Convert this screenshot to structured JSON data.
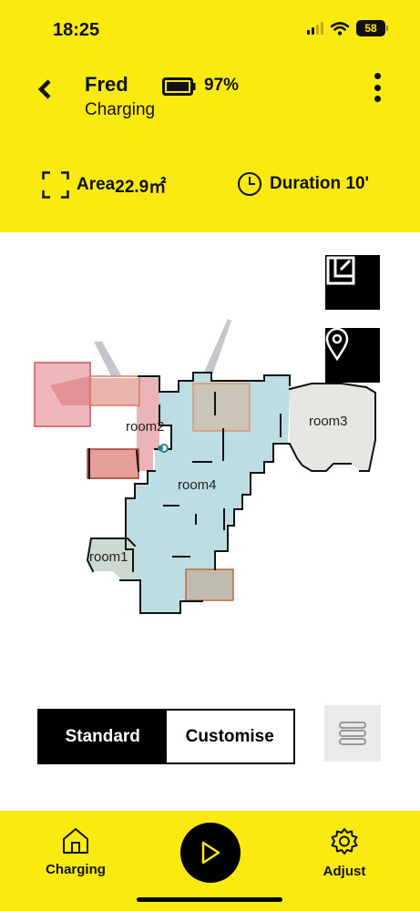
{
  "status_bar": {
    "time": "18:25",
    "battery": "58"
  },
  "header": {
    "robot_name": "Fred",
    "robot_status": "Charging",
    "battery_percent": "97%",
    "area_label": "Area",
    "area_value": "22.9㎡",
    "duration_label": "Duration 10'"
  },
  "map": {
    "rooms": [
      {
        "name": "room1"
      },
      {
        "name": "room2"
      },
      {
        "name": "room3"
      },
      {
        "name": "room4"
      }
    ],
    "colors": {
      "room4": "#bcdde1",
      "room3": "#e6e6e2",
      "room1": "#cdd8d0",
      "room2": "#ebb5b8",
      "zone_fill": "#e89a96",
      "zone_border": "#c2353b",
      "wall": "#111111"
    }
  },
  "mode": {
    "standard": "Standard",
    "customise": "Customise",
    "selected": "Standard"
  },
  "bottom_nav": {
    "charging": "Charging",
    "adjust": "Adjust"
  },
  "icons": {
    "back": "chevron-left-icon",
    "battery": "battery-icon",
    "more": "more-vertical-icon",
    "area": "area-frame-icon",
    "duration": "clock-icon",
    "edit_map": "map-edit-icon",
    "location": "location-pin-icon",
    "list": "list-icon",
    "home": "home-icon",
    "play": "play-icon",
    "settings": "gear-icon"
  },
  "theme": {
    "accent": "#fbea10",
    "dark": "#000000"
  }
}
